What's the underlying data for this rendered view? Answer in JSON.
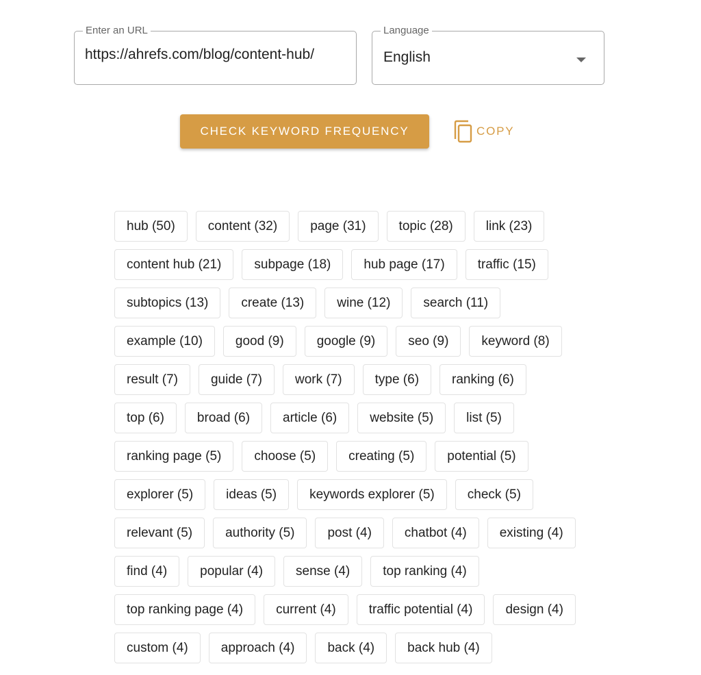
{
  "url_field": {
    "label": "Enter an URL",
    "value": "https://ahrefs.com/blog/content-hub/"
  },
  "language_field": {
    "label": "Language",
    "selected": "English"
  },
  "actions": {
    "check_label": "CHECK KEYWORD FREQUENCY",
    "copy_label": "COPY"
  },
  "colors": {
    "accent": "#d69c45"
  },
  "keywords": [
    {
      "word": "hub",
      "count": 50
    },
    {
      "word": "content",
      "count": 32
    },
    {
      "word": "page",
      "count": 31
    },
    {
      "word": "topic",
      "count": 28
    },
    {
      "word": "link",
      "count": 23
    },
    {
      "word": "content hub",
      "count": 21
    },
    {
      "word": "subpage",
      "count": 18
    },
    {
      "word": "hub page",
      "count": 17
    },
    {
      "word": "traffic",
      "count": 15
    },
    {
      "word": "subtopics",
      "count": 13
    },
    {
      "word": "create",
      "count": 13
    },
    {
      "word": "wine",
      "count": 12
    },
    {
      "word": "search",
      "count": 11
    },
    {
      "word": "example",
      "count": 10
    },
    {
      "word": "good",
      "count": 9
    },
    {
      "word": "google",
      "count": 9
    },
    {
      "word": "seo",
      "count": 9
    },
    {
      "word": "keyword",
      "count": 8
    },
    {
      "word": "result",
      "count": 7
    },
    {
      "word": "guide",
      "count": 7
    },
    {
      "word": "work",
      "count": 7
    },
    {
      "word": "type",
      "count": 6
    },
    {
      "word": "ranking",
      "count": 6
    },
    {
      "word": "top",
      "count": 6
    },
    {
      "word": "broad",
      "count": 6
    },
    {
      "word": "article",
      "count": 6
    },
    {
      "word": "website",
      "count": 5
    },
    {
      "word": "list",
      "count": 5
    },
    {
      "word": "ranking page",
      "count": 5
    },
    {
      "word": "choose",
      "count": 5
    },
    {
      "word": "creating",
      "count": 5
    },
    {
      "word": "potential",
      "count": 5
    },
    {
      "word": "explorer",
      "count": 5
    },
    {
      "word": "ideas",
      "count": 5
    },
    {
      "word": "keywords explorer",
      "count": 5
    },
    {
      "word": "check",
      "count": 5
    },
    {
      "word": "relevant",
      "count": 5
    },
    {
      "word": "authority",
      "count": 5
    },
    {
      "word": "post",
      "count": 4
    },
    {
      "word": "chatbot",
      "count": 4
    },
    {
      "word": "existing",
      "count": 4
    },
    {
      "word": "find",
      "count": 4
    },
    {
      "word": "popular",
      "count": 4
    },
    {
      "word": "sense",
      "count": 4
    },
    {
      "word": "top ranking",
      "count": 4
    },
    {
      "word": "top ranking page",
      "count": 4
    },
    {
      "word": "current",
      "count": 4
    },
    {
      "word": "traffic potential",
      "count": 4
    },
    {
      "word": "design",
      "count": 4
    },
    {
      "word": "custom",
      "count": 4
    },
    {
      "word": "approach",
      "count": 4
    },
    {
      "word": "back",
      "count": 4
    },
    {
      "word": "back hub",
      "count": 4
    }
  ]
}
